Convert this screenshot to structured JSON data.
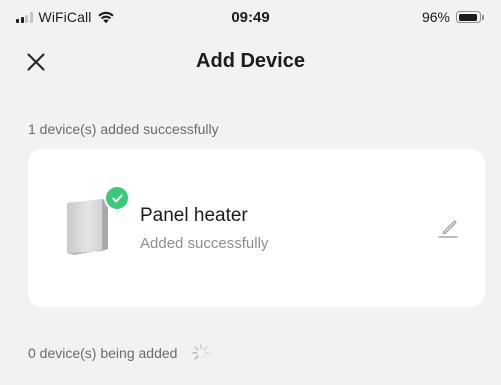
{
  "status_bar": {
    "carrier": "WiFiCall",
    "time": "09:49",
    "battery_percent_text": "96%",
    "battery_level": 0.96,
    "signal_bars_active": 2,
    "signal_bars_total": 4
  },
  "nav": {
    "title": "Add Device",
    "close_icon": "close-icon"
  },
  "added_section": {
    "label": "1 device(s) added successfully"
  },
  "device": {
    "name": "Panel heater",
    "status": "Added successfully",
    "badge_icon": "check-icon",
    "edit_icon": "pencil-icon"
  },
  "adding_section": {
    "label": "0 device(s) being added",
    "icon": "loading-spinner-icon"
  },
  "colors": {
    "background": "#f2f2f4",
    "card": "#ffffff",
    "success_badge": "#3bc87a",
    "primary_text": "#1c1c1e",
    "secondary_text": "#6b6b70"
  }
}
